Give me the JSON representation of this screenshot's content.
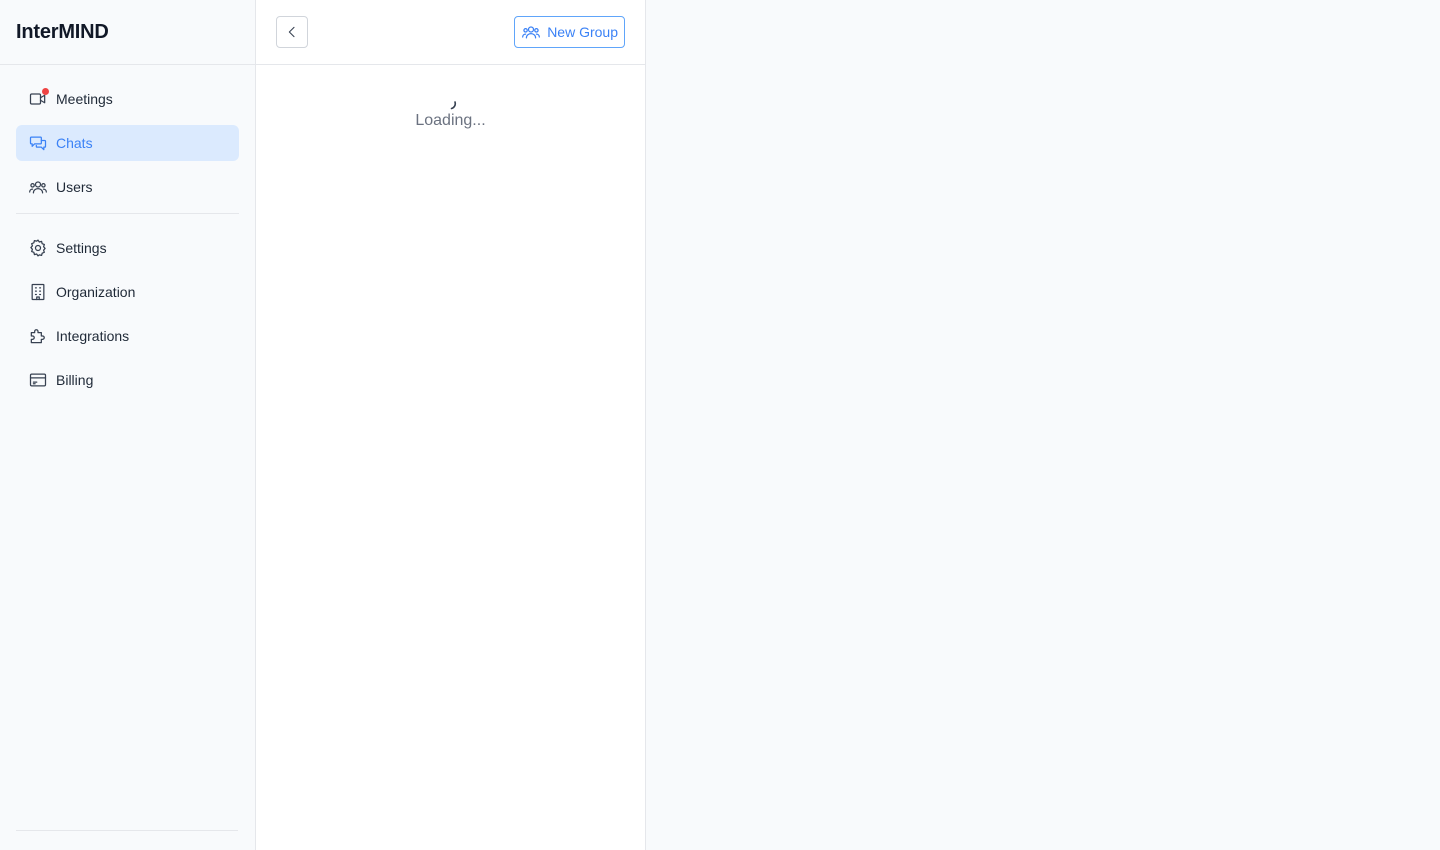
{
  "app": {
    "title": "InterMIND"
  },
  "sidebar": {
    "primary_items": [
      {
        "label": "Meetings",
        "icon": "video-camera-icon",
        "has_notification": true,
        "active": false
      },
      {
        "label": "Chats",
        "icon": "chat-bubbles-icon",
        "active": true
      },
      {
        "label": "Users",
        "icon": "users-icon",
        "active": false
      }
    ],
    "secondary_items": [
      {
        "label": "Settings",
        "icon": "gear-icon"
      },
      {
        "label": "Organization",
        "icon": "building-icon"
      },
      {
        "label": "Integrations",
        "icon": "puzzle-icon"
      },
      {
        "label": "Billing",
        "icon": "credit-card-icon"
      }
    ]
  },
  "chat_panel": {
    "new_group_label": "New Group",
    "loading_text": "Loading..."
  },
  "colors": {
    "accent": "#3b82f6",
    "active_bg": "#dbeafe",
    "notification": "#ef4444"
  }
}
